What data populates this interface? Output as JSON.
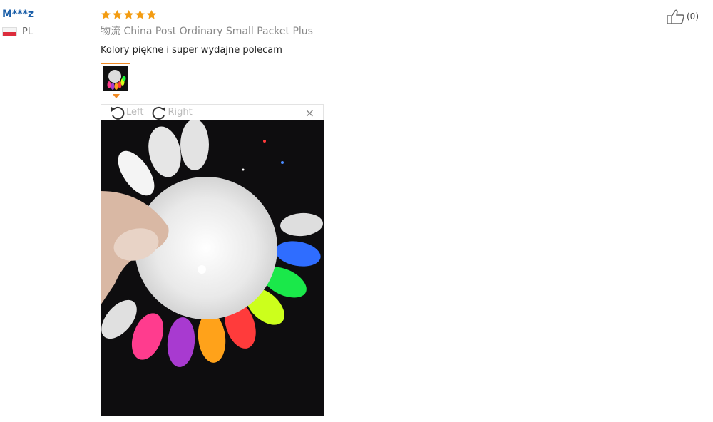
{
  "reviewer": {
    "name": "M***z",
    "country_code": "PL",
    "flag": "poland-flag"
  },
  "rating": {
    "value": 5,
    "max": 5,
    "star_color": "#f39c12"
  },
  "logistics": {
    "prefix": "物流",
    "method": "China Post Ordinary Small Packet Plus"
  },
  "comment": "Kolory piękne i super wydajne polecam",
  "viewer": {
    "rotate_left_label": "Left",
    "rotate_right_label": "Right",
    "close_symbol": "×"
  },
  "helpful": {
    "count": "(0)"
  }
}
